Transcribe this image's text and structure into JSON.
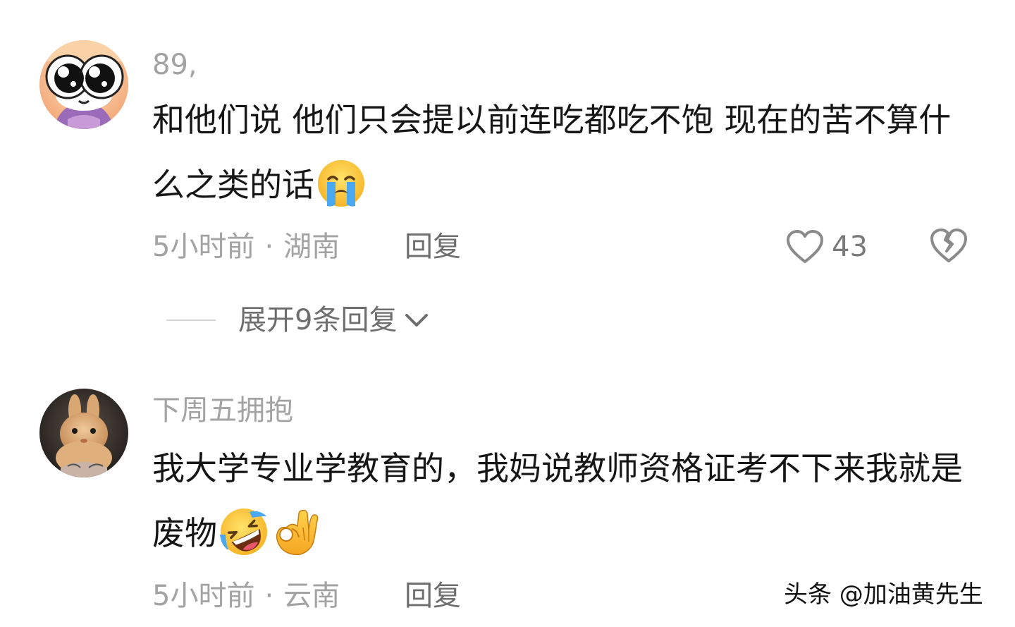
{
  "comments": [
    {
      "username": "89,",
      "avatar_icon": "cartoon-big-eyes-avatar",
      "text": "和他们说 他们只会提以前连吃都吃不饱 现在的苦不算什么之类的话",
      "emojis": [
        "crying-face-emoji"
      ],
      "time": "5小时前",
      "separator": "·",
      "location": "湖南",
      "reply_label": "回复",
      "like_icon": "heart-outline-icon",
      "like_count": "43",
      "dislike_icon": "broken-heart-icon",
      "expand_label": "展开9条回复",
      "expand_icon": "chevron-down-icon"
    },
    {
      "username": "下周五拥抱",
      "avatar_icon": "bunny-photo-avatar",
      "text": "我大学专业学教育的，我妈说教师资格证考不下来我就是废物",
      "emojis": [
        "rolling-on-floor-laughing-emoji",
        "ok-hand-emoji"
      ],
      "time": "5小时前",
      "separator": "·",
      "location": "云南",
      "reply_label": "回复"
    }
  ],
  "watermark": "头条 @加油黄先生",
  "colors": {
    "text_primary": "#161616",
    "text_secondary": "#a3a3a3",
    "reply_text": "#6e6e6e",
    "background": "#ffffff"
  }
}
